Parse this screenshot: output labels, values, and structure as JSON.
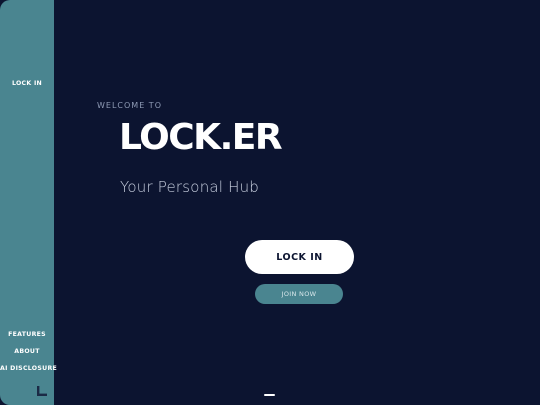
{
  "sidebar": {
    "top_link": "LOCK IN",
    "bottom_links": [
      "FEATURES",
      "ABOUT",
      "AI DISCLOSURE"
    ],
    "logo_icon": "L-logo-icon"
  },
  "hero": {
    "welcome": "WELCOME TO",
    "brand": "LOCK.ER",
    "tagline": "Your Personal Hub",
    "primary_button": "LOCK IN",
    "secondary_button": "JOIN NOW"
  },
  "colors": {
    "background": "#0c1430",
    "sidebar": "#4a8590",
    "accent": "#4a8590",
    "primary_button_bg": "#ffffff",
    "text_light": "#ffffff"
  }
}
